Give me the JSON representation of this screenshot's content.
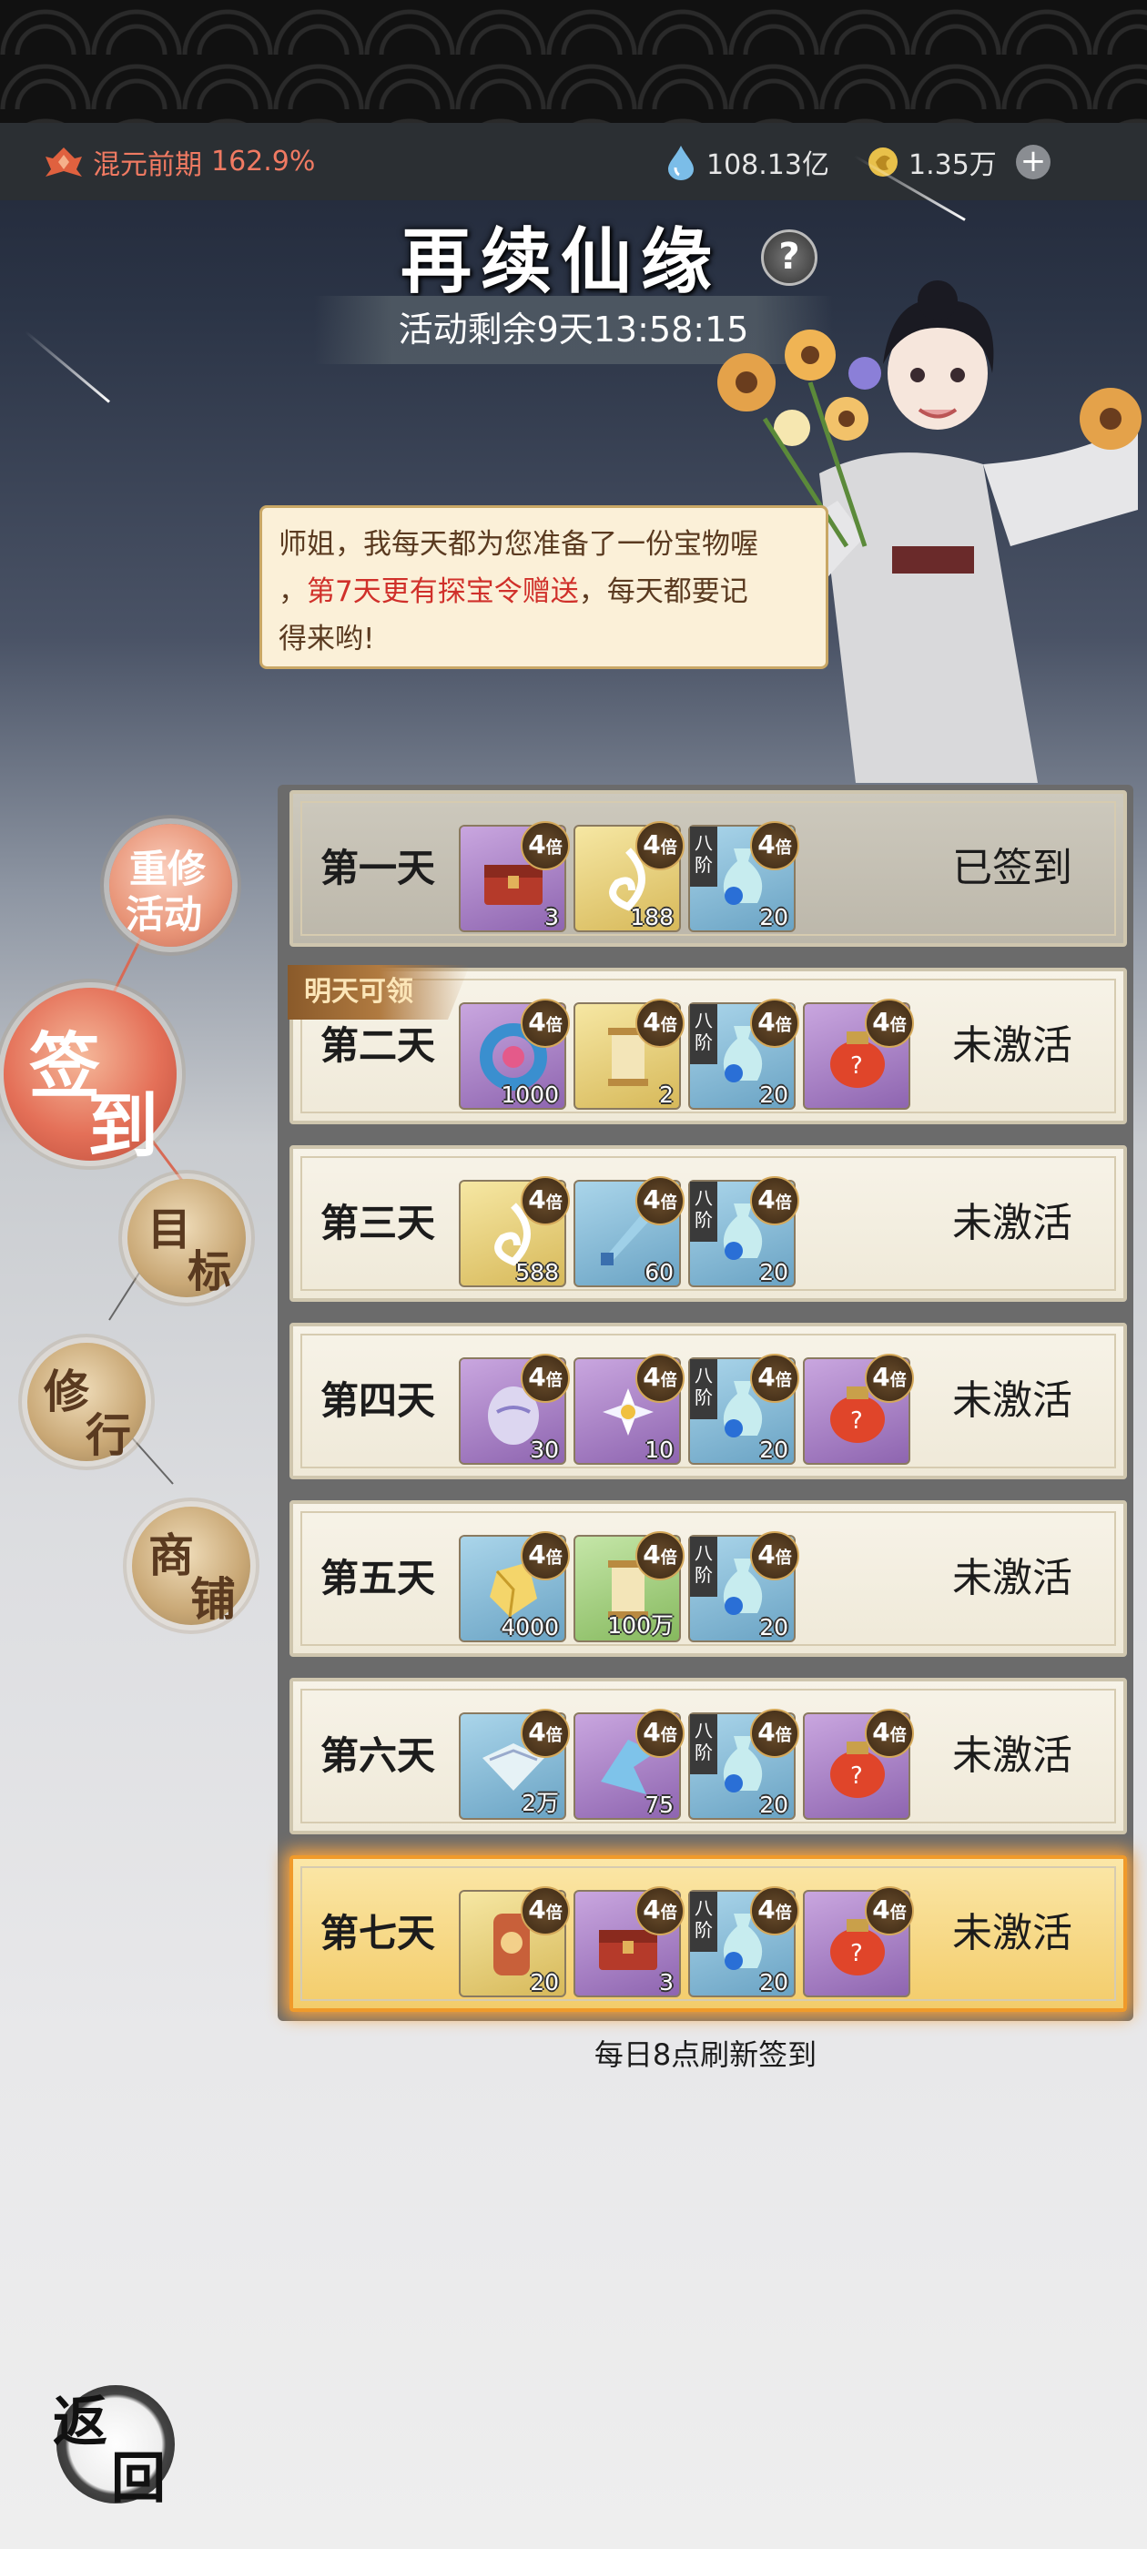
{
  "header": {
    "realm": "混元前期",
    "realm_percent": "162.9%",
    "currency1": "108.13亿",
    "currency2": "1.35万",
    "plus": "+"
  },
  "event": {
    "title": "再续仙缘",
    "help": "?",
    "timer": "活动剩余9天13:58:15"
  },
  "bubble": {
    "line1": "师姐，我每天都为您准备了一份宝物喔",
    "line2_a": "，",
    "line2_hl": "第7天更有探宝令赠送",
    "line2_b": "，每天都要记",
    "line3": "得来哟!"
  },
  "nav": {
    "reset_1": "重修",
    "reset_2": "活动",
    "signin_1": "签",
    "signin_2": "到",
    "goal_1": "目",
    "goal_2": "标",
    "practice_1": "修",
    "practice_2": "行",
    "shop_1": "商",
    "shop_2": "铺"
  },
  "tomorrow_badge": "明天可领",
  "multiplier": "4",
  "multiplier_unit": "倍",
  "tier_1": "八",
  "tier_2": "阶",
  "days": [
    {
      "label": "第一天",
      "status": "已签到",
      "items": [
        {
          "count": "3"
        },
        {
          "count": "188"
        },
        {
          "count": "20"
        }
      ]
    },
    {
      "label": "第二天",
      "status": "未激活",
      "items": [
        {
          "count": "1000"
        },
        {
          "count": "2"
        },
        {
          "count": "20"
        },
        {
          "count": ""
        }
      ]
    },
    {
      "label": "第三天",
      "status": "未激活",
      "items": [
        {
          "count": "588"
        },
        {
          "count": "60"
        },
        {
          "count": "20"
        }
      ]
    },
    {
      "label": "第四天",
      "status": "未激活",
      "items": [
        {
          "count": "30"
        },
        {
          "count": "10"
        },
        {
          "count": "20"
        },
        {
          "count": ""
        }
      ]
    },
    {
      "label": "第五天",
      "status": "未激活",
      "items": [
        {
          "count": "4000"
        },
        {
          "count": "100万"
        },
        {
          "count": "20"
        }
      ]
    },
    {
      "label": "第六天",
      "status": "未激活",
      "items": [
        {
          "count": "2万"
        },
        {
          "count": "75"
        },
        {
          "count": "20"
        },
        {
          "count": ""
        }
      ]
    },
    {
      "label": "第七天",
      "status": "未激活",
      "items": [
        {
          "count": "20"
        },
        {
          "count": "3"
        },
        {
          "count": "20"
        },
        {
          "count": ""
        }
      ]
    }
  ],
  "footer_note": "每日8点刷新签到",
  "back": {
    "c1": "返",
    "c2": "回"
  },
  "colors": {
    "accent": "#e47058",
    "highlight": "#d0302a",
    "gold": "#f3cc6a"
  }
}
